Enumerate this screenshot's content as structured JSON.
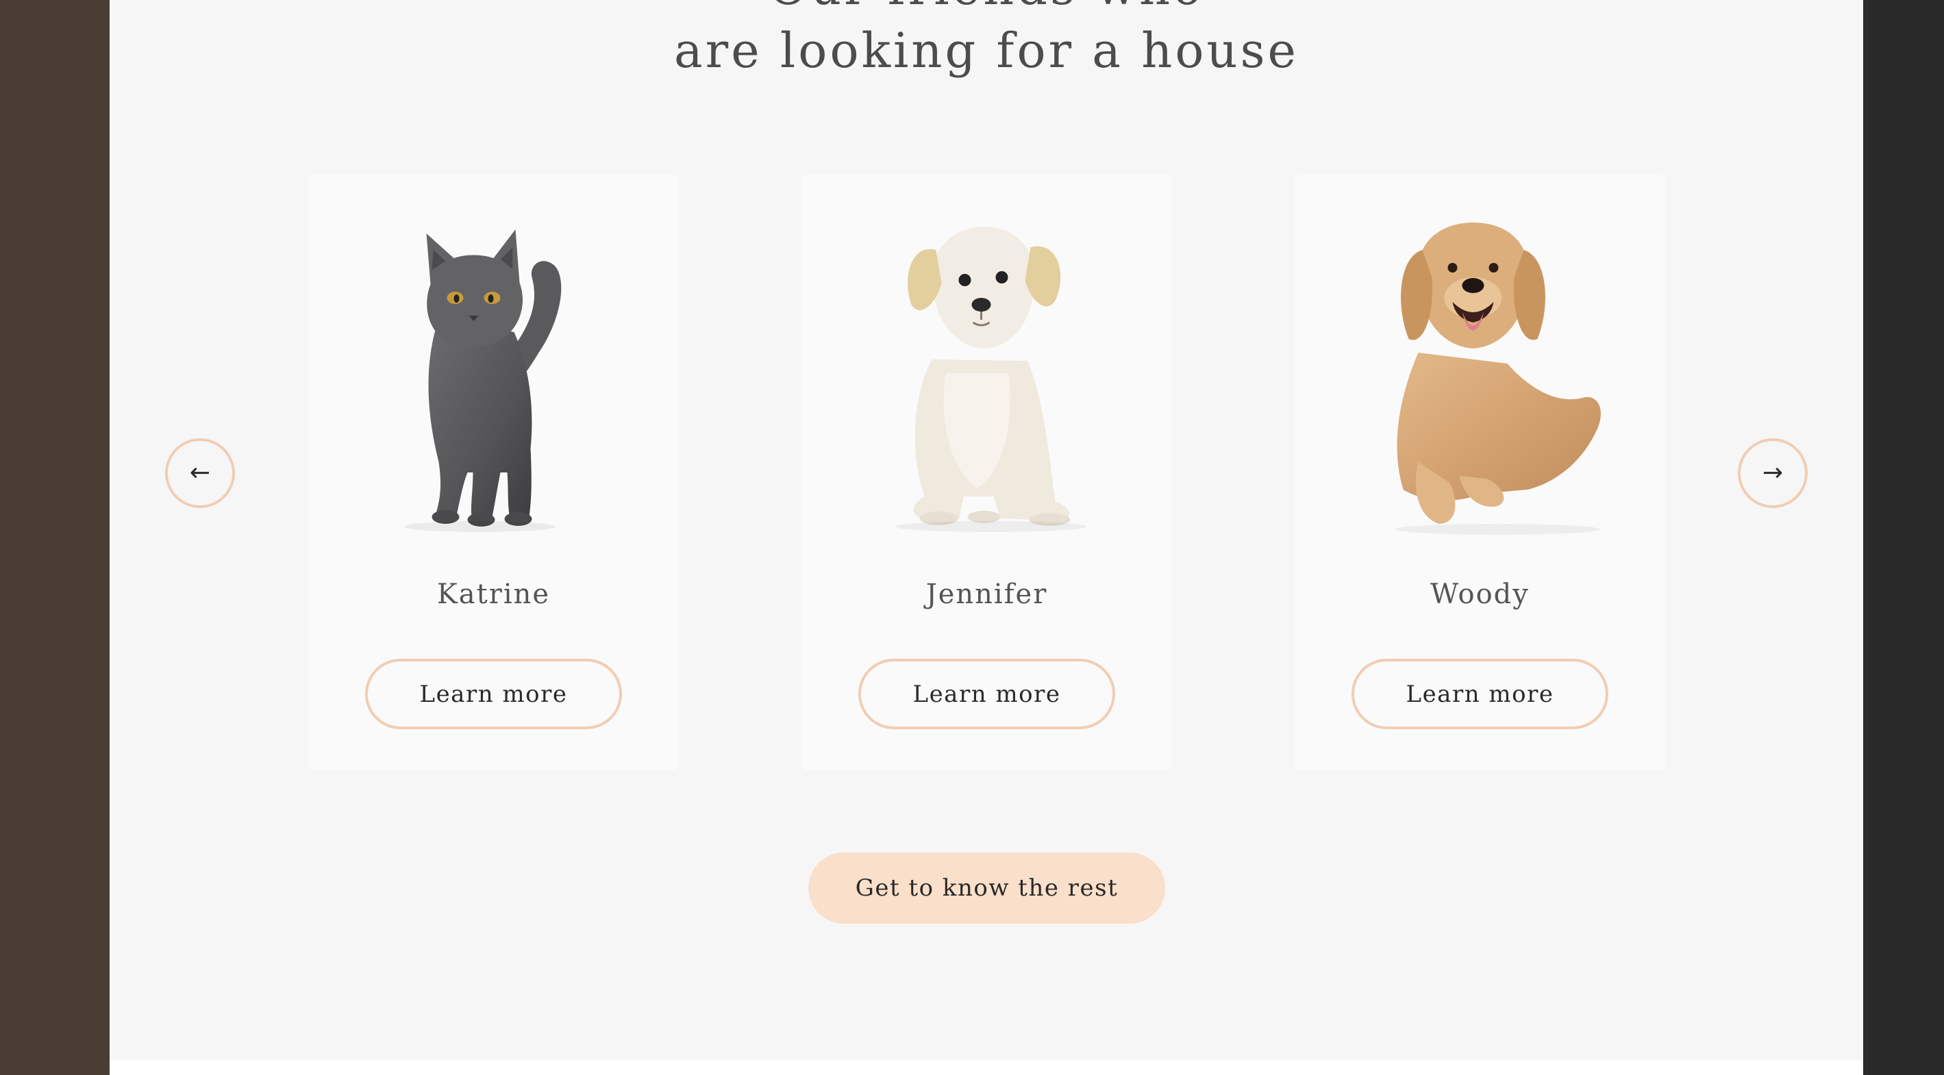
{
  "section": {
    "title_line_1": "Our friends who",
    "title_line_2": "are looking for a house"
  },
  "slider": {
    "prev_label": "←",
    "next_label": "→"
  },
  "pets": [
    {
      "name": "Katrine",
      "image_icon": "gray-cat-photo",
      "button_label": "Learn more"
    },
    {
      "name": "Jennifer",
      "image_icon": "cream-puppy-photo",
      "button_label": "Learn more"
    },
    {
      "name": "Woody",
      "image_icon": "golden-retriever-photo",
      "button_label": "Learn more"
    }
  ],
  "cta": {
    "label": "Get to know the rest"
  },
  "colors": {
    "accent_border": "#f1cdb3",
    "cta_fill": "#fadfca",
    "section_bg": "#f6f6f6",
    "card_bg": "#fafafa",
    "text_dark": "#292929",
    "left_strip": "#4a3d35",
    "right_strip": "#292929"
  }
}
